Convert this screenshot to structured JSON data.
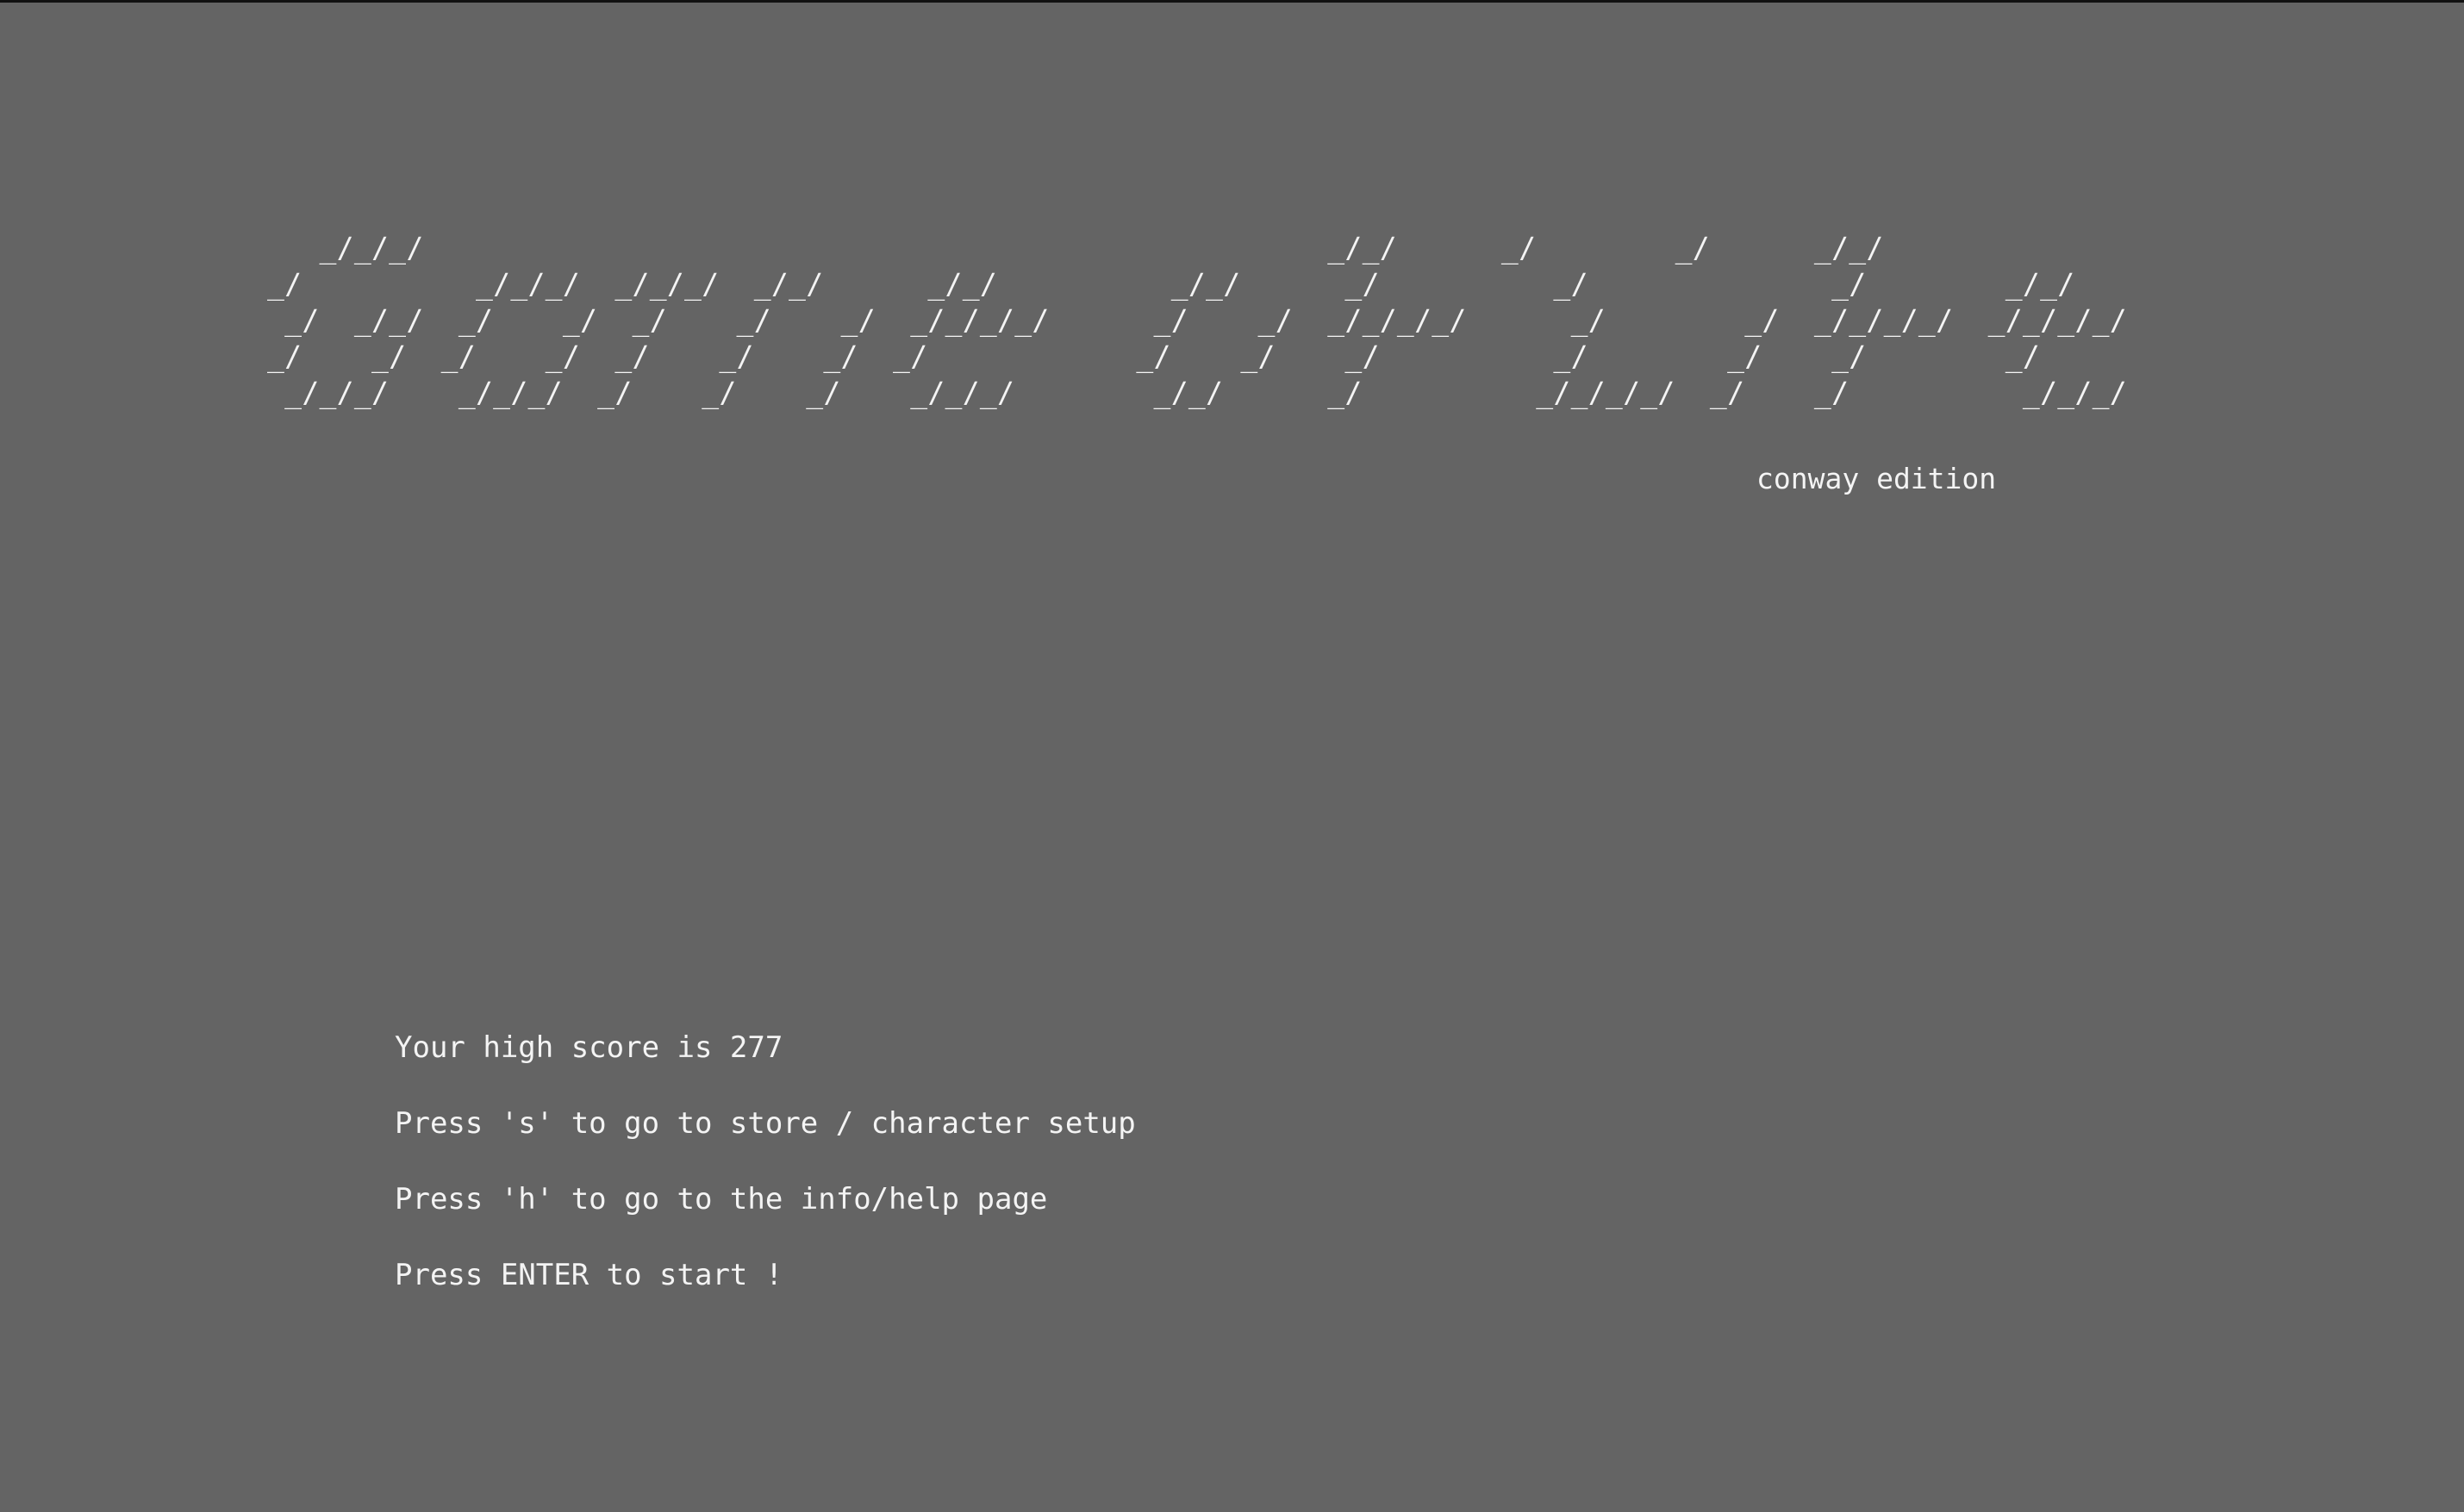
{
  "title_art": [
    "   _/_/_/                                                    _/_/      _/        _/      _/_/",
    "_/          _/_/_/  _/_/_/  _/_/      _/_/          _/_/      _/          _/              _/        _/_/",
    " _/  _/_/  _/    _/  _/    _/    _/  _/_/_/_/      _/    _/  _/_/_/_/      _/        _/  _/_/_/_/  _/_/_/_/",
    "_/    _/  _/    _/  _/    _/    _/  _/            _/    _/    _/          _/        _/    _/        _/",
    " _/_/_/    _/_/_/  _/    _/    _/    _/_/_/        _/_/      _/          _/_/_/_/  _/    _/          _/_/_/"
  ],
  "subtitle": "conway edition",
  "high_score_line": "Your high score is 277",
  "store_hint": "Press 's' to go to store / character setup",
  "help_hint": "Press 'h' to go to the info/help page",
  "start_hint": "Press ENTER to start !",
  "colors": {
    "background": "#646464",
    "text": "#f4f4f4"
  }
}
